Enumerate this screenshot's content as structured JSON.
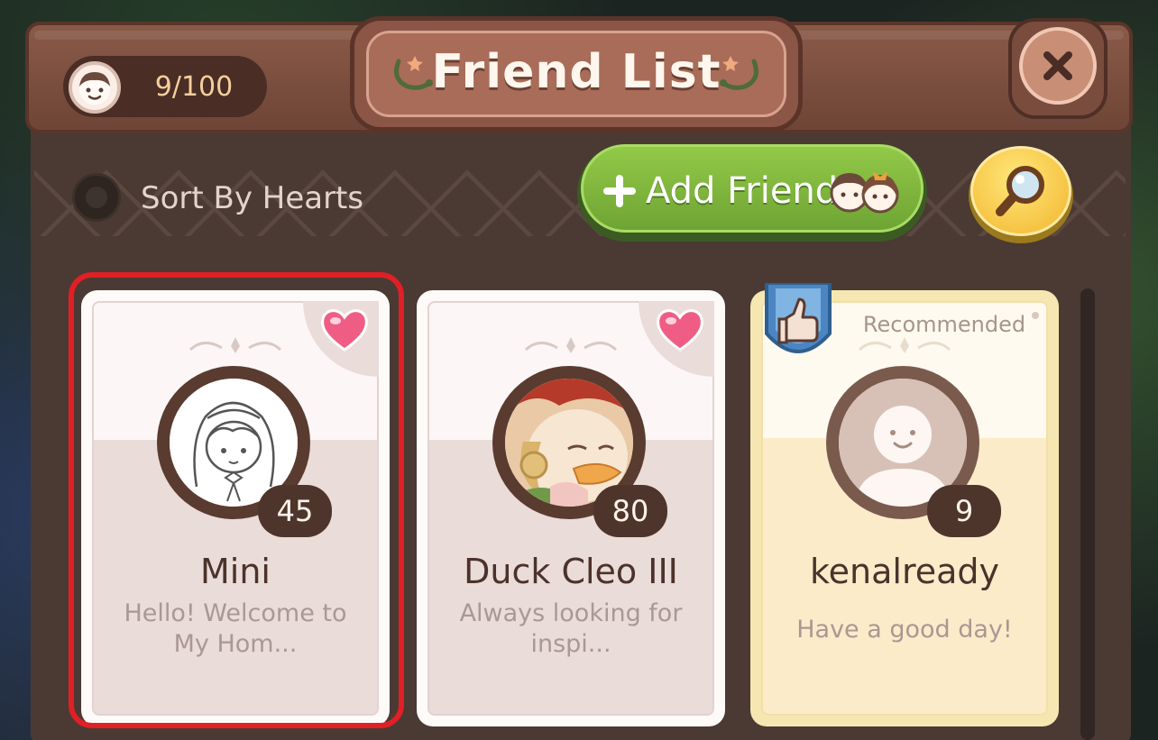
{
  "header": {
    "title": "Friend List",
    "friend_count": "9/100",
    "close_icon": "close-icon"
  },
  "toolbar": {
    "sort_label": "Sort By Hearts",
    "sort_selected": false,
    "add_friend_label": "Add Friend",
    "search_icon": "magnifier-icon"
  },
  "friends": [
    {
      "name": "Mini",
      "level": "45",
      "message": "Hello! Welcome to My Hom...",
      "heart": true,
      "recommended": false,
      "selected": true
    },
    {
      "name": "Duck Cleo III",
      "level": "80",
      "message": "Always looking for inspi...",
      "heart": true,
      "recommended": false,
      "selected": false
    },
    {
      "name": "kenalready",
      "level": "9",
      "message": "Have a good day!",
      "heart": false,
      "recommended": true,
      "recommended_label": "Recommended",
      "selected": false
    }
  ],
  "colors": {
    "frame": "#4b3a32",
    "title_plate": "#a86c58",
    "add_button": "#7fb63c",
    "search_button": "#f2b52d",
    "selection": "#e11f26",
    "recommended_card": "#f6e7b2"
  }
}
